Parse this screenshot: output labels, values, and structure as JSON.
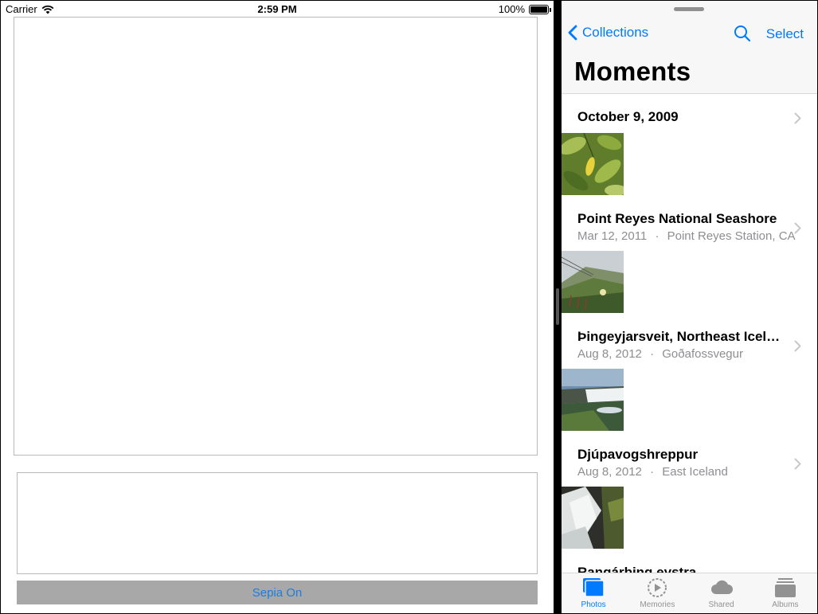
{
  "status_bar": {
    "carrier": "Carrier",
    "time": "2:59 PM",
    "battery": "100%",
    "wifi_icon": "wifi-icon",
    "battery_icon": "battery-icon"
  },
  "left_app": {
    "sepia_button_label": "Sepia On",
    "accent": "#1f7bde",
    "button_bg": "#a8a8a8"
  },
  "photos": {
    "nav": {
      "back_label": "Collections",
      "select_label": "Select",
      "title": "Moments",
      "search_icon": "search-icon"
    },
    "moments": [
      {
        "title": "October 9, 2009",
        "date": "",
        "location": "",
        "thumb": "lemon-tree"
      },
      {
        "title": "Point Reyes National Seashore",
        "date": "Mar 12, 2011",
        "location": "Point Reyes Station, CA",
        "thumb": "hillside"
      },
      {
        "title": "Þingeyjarsveit, Northeast Icel…",
        "date": "Aug 8, 2012",
        "location": "Goðafossvegur",
        "thumb": "waterfall"
      },
      {
        "title": "Djúpavogshreppur",
        "date": "Aug 8, 2012",
        "location": "East Iceland",
        "thumb": "cascade"
      },
      {
        "title": "Rangárþing eystra",
        "date": "",
        "location": "",
        "thumb": ""
      }
    ],
    "separator": "·",
    "tabs": [
      {
        "label": "Photos",
        "icon": "photos-icon",
        "active": true
      },
      {
        "label": "Memories",
        "icon": "memories-icon",
        "active": false
      },
      {
        "label": "Shared",
        "icon": "cloud-icon",
        "active": false
      },
      {
        "label": "Albums",
        "icon": "albums-icon",
        "active": false
      }
    ],
    "accent": "#007aff"
  }
}
